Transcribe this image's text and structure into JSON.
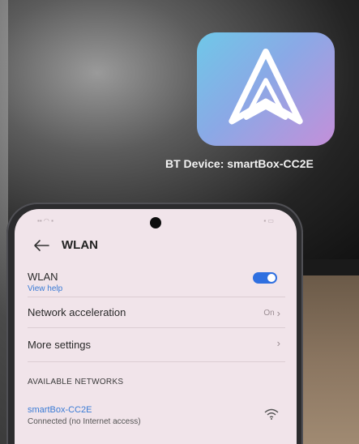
{
  "tv": {
    "bt_device_text": "BT Device: smartBox-CC2E",
    "app_icon": "android-auto-icon"
  },
  "phone": {
    "header": {
      "title": "WLAN",
      "back_icon": "back-arrow-icon"
    },
    "wlan": {
      "label": "WLAN",
      "help": "View help",
      "enabled": true
    },
    "network_acceleration": {
      "label": "Network acceleration",
      "value": "On"
    },
    "more_settings": {
      "label": "More settings"
    },
    "available_networks": {
      "heading": "AVAILABLE NETWORKS",
      "items": [
        {
          "name": "smartBox-CC2E",
          "status": "Connected (no Internet access)",
          "icon": "wifi-icon"
        }
      ]
    }
  },
  "colors": {
    "accent": "#2f6fe0",
    "link": "#3a7bd5",
    "screen_bg": "#f1e4ea"
  }
}
